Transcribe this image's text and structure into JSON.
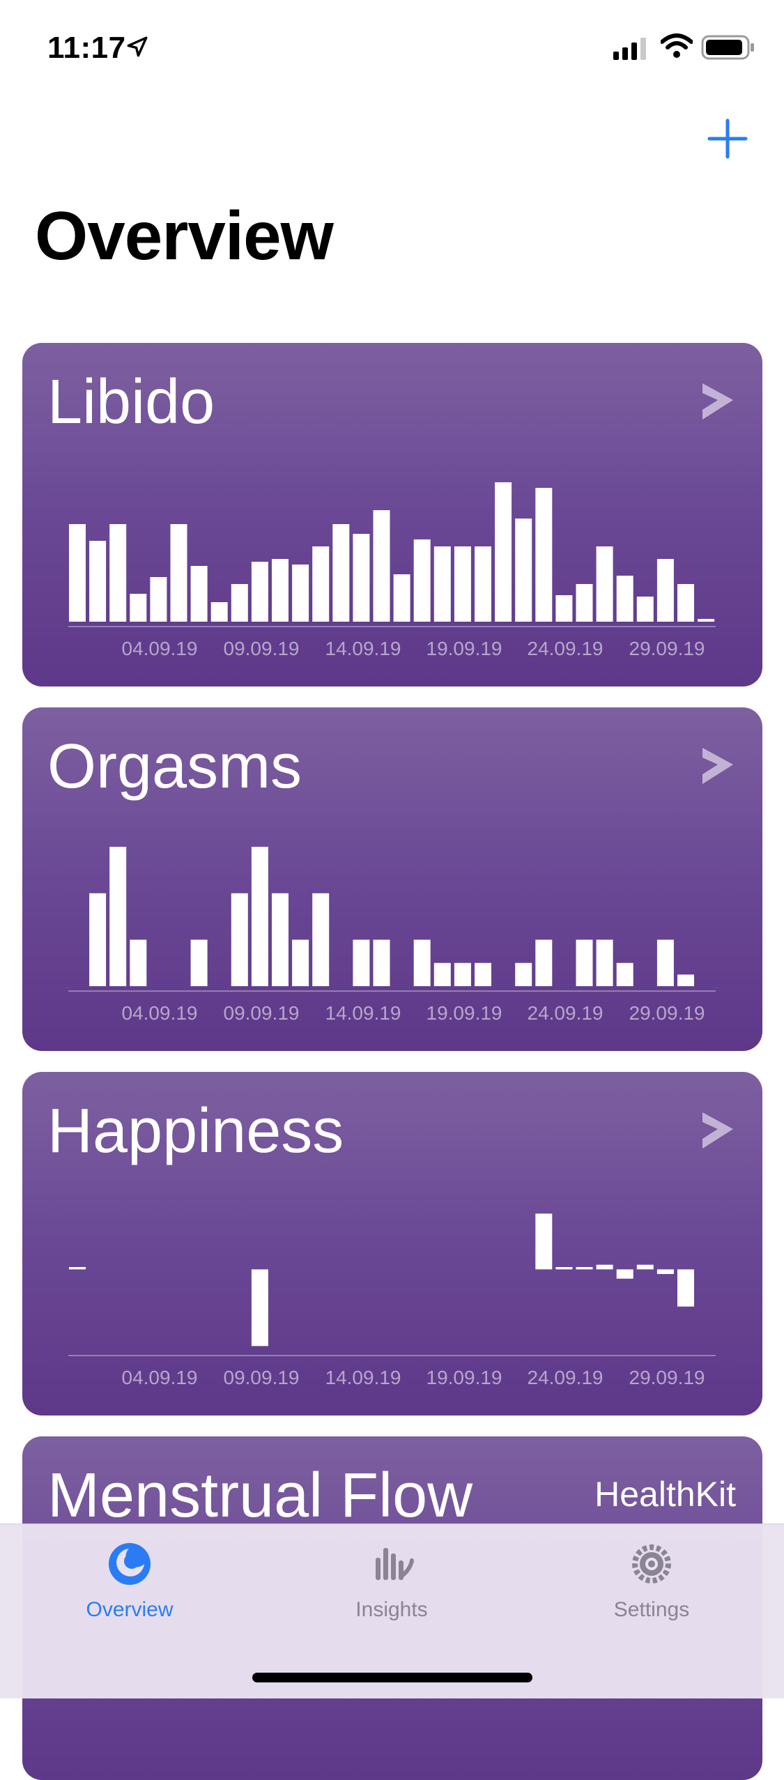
{
  "status_bar": {
    "time": "11:17"
  },
  "header": {
    "title": "Overview"
  },
  "theme": {
    "accent": "#2a7cf5",
    "card_top": "#7d60a0",
    "card_bottom": "#5e3889",
    "tick": "#b7a6cb"
  },
  "cards": [
    {
      "title": "Libido",
      "chevron": "chevron-right-icon"
    },
    {
      "title": "Orgasms",
      "chevron": "chevron-right-icon"
    },
    {
      "title": "Happiness",
      "chevron": "chevron-right-icon"
    },
    {
      "title": "Menstrual Flow",
      "badge": "HealthKit"
    }
  ],
  "chart_data": [
    {
      "type": "bar",
      "title": "Libido",
      "tick_labels": [
        "04.09.19",
        "09.09.19",
        "14.09.19",
        "19.09.19",
        "24.09.19",
        "29.09.19"
      ],
      "values": [
        7,
        5.8,
        7,
        2,
        3.2,
        7,
        4,
        1.4,
        2.7,
        4.3,
        4.5,
        4.1,
        5.4,
        7,
        6.3,
        8,
        3.4,
        5.9,
        5.4,
        5.4,
        5.4,
        10,
        7.4,
        9.6,
        1.9,
        2.7,
        5.4,
        3.3,
        1.8,
        4.5,
        2.7,
        0.2
      ],
      "ylim": [
        0,
        10
      ]
    },
    {
      "type": "bar",
      "title": "Orgasms",
      "tick_labels": [
        "04.09.19",
        "09.09.19",
        "14.09.19",
        "19.09.19",
        "24.09.19",
        "29.09.19"
      ],
      "values": [
        0,
        2,
        3,
        1,
        0,
        0,
        1,
        0,
        2,
        3,
        2,
        1,
        2,
        0,
        1,
        1,
        0,
        1,
        0.5,
        0.5,
        0.5,
        0,
        0.5,
        1,
        0,
        1,
        1,
        0.5,
        0,
        1,
        0.25,
        0
      ],
      "ylim": [
        0,
        3
      ]
    },
    {
      "type": "bar",
      "title": "Happiness",
      "tick_labels": [
        "04.09.19",
        "09.09.19",
        "14.09.19",
        "19.09.19",
        "24.09.19",
        "29.09.19"
      ],
      "values": [
        0.1,
        0,
        0,
        0,
        0,
        0,
        0,
        0,
        0,
        -3.3,
        0,
        0,
        0,
        0,
        0,
        0,
        0,
        0,
        0,
        0,
        0,
        0,
        0,
        2.4,
        0.1,
        0.1,
        0.2,
        -0.4,
        0.2,
        -0.2,
        -1.6,
        0
      ],
      "baseline": 0,
      "ylim": [
        -3.5,
        2.5
      ]
    }
  ],
  "tabs": [
    {
      "label": "Overview",
      "icon": "overview-icon",
      "active": true
    },
    {
      "label": "Insights",
      "icon": "insights-icon",
      "active": false
    },
    {
      "label": "Settings",
      "icon": "settings-gear-icon",
      "active": false
    }
  ]
}
